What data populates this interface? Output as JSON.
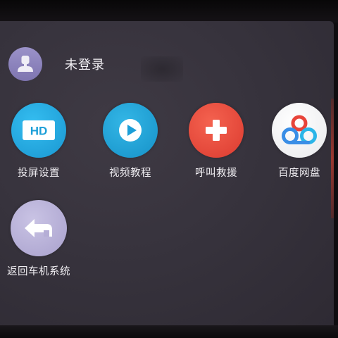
{
  "user": {
    "status_label": "未登录"
  },
  "apps": [
    {
      "label": "投屏设置",
      "icon": "hd-icon",
      "color": "#22a9de"
    },
    {
      "label": "视频教程",
      "icon": "play-icon",
      "color": "#1fa3d6"
    },
    {
      "label": "呼叫救援",
      "icon": "cross-icon",
      "color": "#ea4a3c"
    },
    {
      "label": "百度网盘",
      "icon": "baidu-cloud-icon",
      "color": "#f7f7f7"
    },
    {
      "label": "返回车机系统",
      "icon": "back-arrow-icon",
      "color": "#b9b2d8"
    }
  ]
}
